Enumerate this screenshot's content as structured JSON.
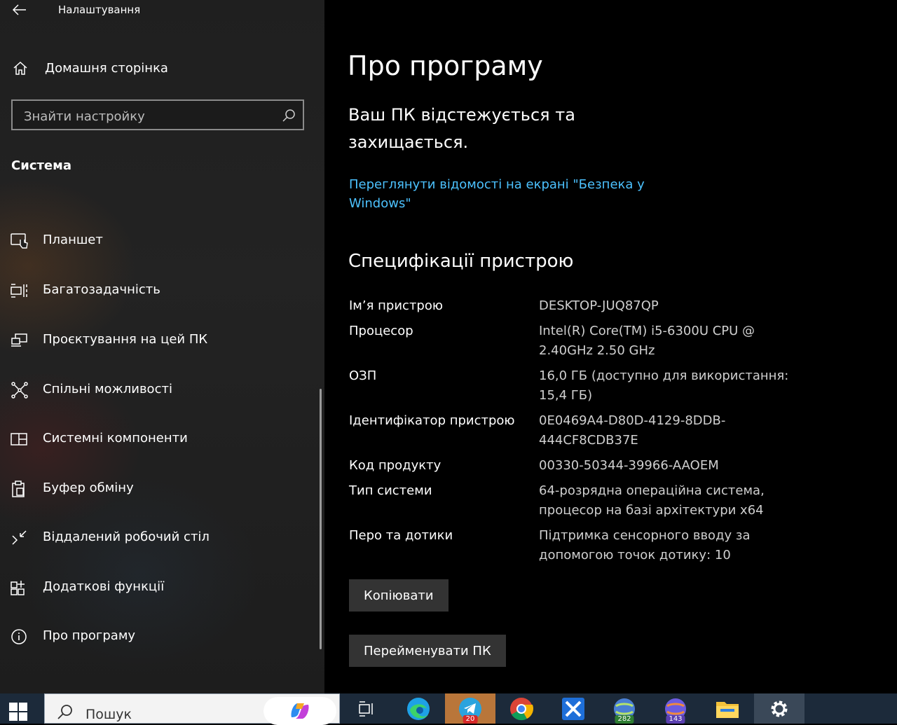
{
  "window": {
    "title": "Налаштування"
  },
  "sidebar": {
    "home_label": "Домашня сторінка",
    "search_placeholder": "Знайти настройку",
    "section_title": "Система",
    "items": [
      {
        "label": "Планшет",
        "icon": "tablet-icon"
      },
      {
        "label": "Багатозадачність",
        "icon": "multitasking-icon"
      },
      {
        "label": "Проєктування на цей ПК",
        "icon": "projecting-icon"
      },
      {
        "label": "Спільні можливості",
        "icon": "shared-experiences-icon"
      },
      {
        "label": "Системні компоненти",
        "icon": "system-components-icon"
      },
      {
        "label": "Буфер обміну",
        "icon": "clipboard-icon"
      },
      {
        "label": "Віддалений робочий стіл",
        "icon": "remote-desktop-icon"
      },
      {
        "label": "Додаткові функції",
        "icon": "optional-features-icon"
      },
      {
        "label": "Про програму",
        "icon": "info-icon"
      }
    ]
  },
  "main": {
    "title": "Про програму",
    "security_message": "Ваш ПК відстежується та захищається.",
    "security_link": "Переглянути відомості на екрані \"Безпека у Windows\"",
    "specs_title": "Специфікації пристрою",
    "specs": [
      {
        "key": "Ім’я пристрою",
        "value": "DESKTOP-JUQ87QP"
      },
      {
        "key": "Процесор",
        "value": "Intel(R) Core(TM) i5-6300U CPU @ 2.40GHz   2.50 GHz"
      },
      {
        "key": "ОЗП",
        "value": "16,0 ГБ (доступно для використання: 15,4 ГБ)"
      },
      {
        "key": "Ідентифікатор пристрою",
        "value": "0E0469A4-D80D-4129-8DDB-444CF8CDB37E"
      },
      {
        "key": "Код продукту",
        "value": "00330-50344-39966-AAOEM"
      },
      {
        "key": "Тип системи",
        "value": "64-розрядна операційна система, процесор на базі архітектури x64"
      },
      {
        "key": "Перо та дотики",
        "value": "Підтримка сенсорного вводу за допомогою точок дотику: 10"
      }
    ],
    "copy_button": "Копіювати",
    "rename_button": "Перейменувати ПК"
  },
  "taskbar": {
    "search_label": "Пошук",
    "badges": {
      "telegram": "20",
      "app1": "282",
      "app2": "143"
    },
    "colors": {
      "background": "#1c2a3a",
      "link": "#4cc2ff"
    }
  }
}
